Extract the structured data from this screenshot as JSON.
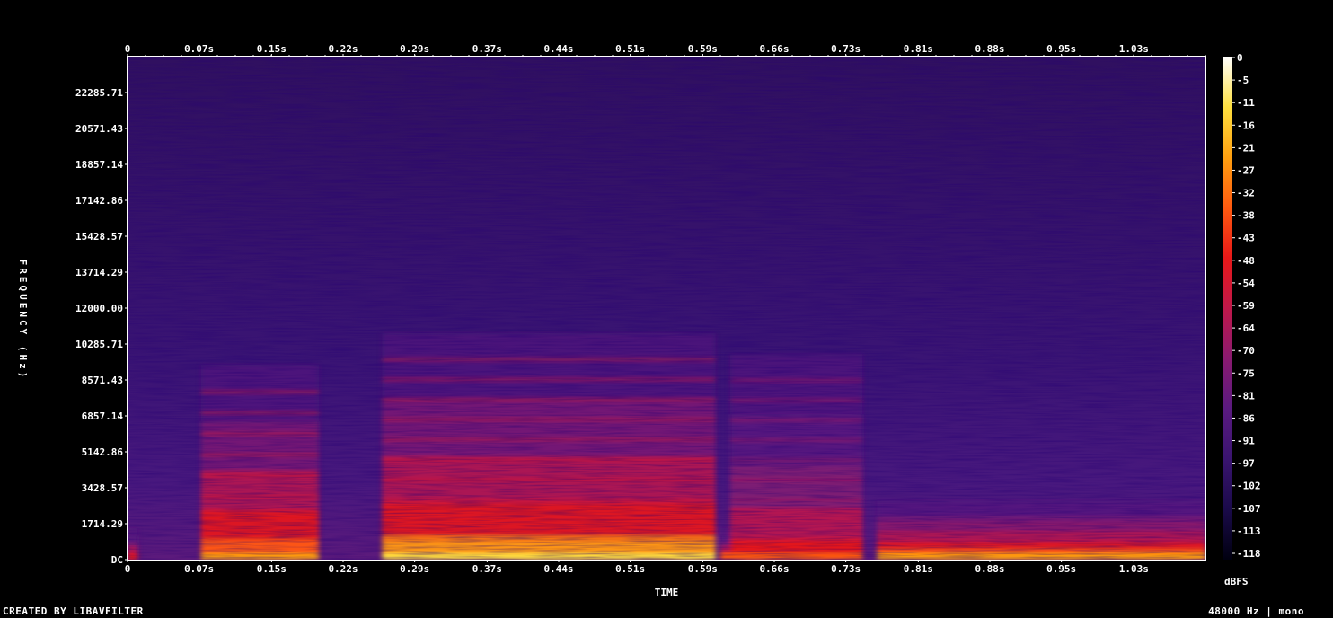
{
  "chart_data": {
    "type": "heatmap",
    "xlabel": "TIME",
    "ylabel": "FREQUENCY (Hz)",
    "x_ticks": [
      "0",
      "0.07s",
      "0.15s",
      "0.22s",
      "0.29s",
      "0.37s",
      "0.44s",
      "0.51s",
      "0.59s",
      "0.66s",
      "0.73s",
      "0.81s",
      "0.88s",
      "0.95s",
      "1.03s"
    ],
    "x_tick_values": [
      0,
      0.073,
      0.147,
      0.22,
      0.293,
      0.367,
      0.44,
      0.513,
      0.587,
      0.66,
      0.733,
      0.807,
      0.88,
      0.953,
      1.027
    ],
    "x_range": [
      0,
      1.1
    ],
    "y_ticks": [
      "DC",
      "1714.29",
      "3428.57",
      "5142.86",
      "6857.14",
      "8571.43",
      "10285.71",
      "12000.00",
      "13714.29",
      "15428.57",
      "17142.86",
      "18857.14",
      "20571.43",
      "22285.71"
    ],
    "y_tick_values": [
      0,
      1714.29,
      3428.57,
      5142.86,
      6857.14,
      8571.43,
      10285.71,
      12000,
      13714.29,
      15428.57,
      17142.86,
      18857.14,
      20571.43,
      22285.71
    ],
    "y_range": [
      0,
      24000
    ],
    "colorbar": {
      "label": "dBFS",
      "ticks": [
        "0",
        "-5",
        "-11",
        "-16",
        "-21",
        "-27",
        "-32",
        "-38",
        "-43",
        "-48",
        "-54",
        "-59",
        "-64",
        "-70",
        "-75",
        "-81",
        "-86",
        "-91",
        "-97",
        "-102",
        "-107",
        "-113",
        "-118"
      ],
      "range": [
        -118,
        0
      ],
      "colormap": [
        "#000010",
        "#1a0a4a",
        "#3a1470",
        "#5a1a80",
        "#8a1a70",
        "#c0184a",
        "#e81818",
        "#ff5a10",
        "#ffa010",
        "#ffe040",
        "#ffffff"
      ]
    },
    "background_level_db": -88,
    "events": [
      {
        "t_start": 0.0,
        "t_end": 0.01,
        "f_max": 1200,
        "level_db": -45
      },
      {
        "t_start": 0.075,
        "t_end": 0.195,
        "f_max": 9000,
        "level_db": -20
      },
      {
        "t_start": 0.26,
        "t_end": 0.6,
        "f_max": 10500,
        "level_db": -12
      },
      {
        "t_start": 0.605,
        "t_end": 0.615,
        "f_max": 1200,
        "level_db": -35
      },
      {
        "t_start": 0.615,
        "t_end": 0.75,
        "f_max": 9500,
        "level_db": -40
      },
      {
        "t_start": 0.765,
        "t_end": 1.1,
        "f_max": 2500,
        "level_db": -28
      }
    ]
  },
  "footer": {
    "left": "CREATED BY LIBAVFILTER",
    "right": "48000 Hz | mono"
  }
}
